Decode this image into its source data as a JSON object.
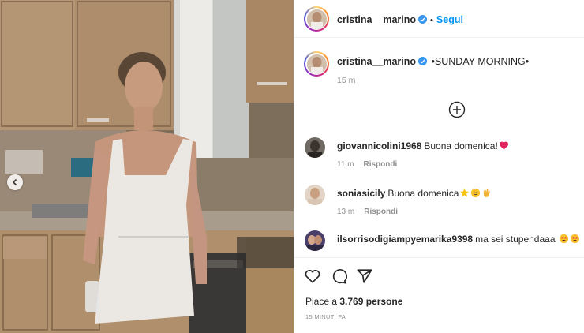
{
  "post": {
    "username": "cristina__marino",
    "follow_label": "Segui",
    "separator": "•",
    "caption": "•SUNDAY MORNING•",
    "caption_time": "15 m",
    "likes_prefix": "Piace a",
    "likes_count": "3.769",
    "likes_suffix": "persone",
    "posted_ago": "15 MINUTI FA"
  },
  "comments": [
    {
      "username": "giovannicolini1968",
      "text": "Buona domenica!",
      "emojis": [
        "red-heart"
      ],
      "time": "11 m",
      "reply_label": "Rispondi"
    },
    {
      "username": "soniasicily",
      "text": "Buona domenica",
      "emojis": [
        "star",
        "smiling-face",
        "waving-hand"
      ],
      "time": "13 m",
      "reply_label": "Rispondi"
    },
    {
      "username": "ilsorrisodigiampyemarika9398",
      "text": "ma sei stupendaaa",
      "emojis": [
        "star-struck",
        "star-struck"
      ],
      "time": "",
      "reply_label": ""
    }
  ],
  "icons": {
    "verified": "verified-badge-icon",
    "load_more": "plus-circle-icon",
    "like": "heart-icon",
    "comment": "comment-icon",
    "share": "paper-plane-icon",
    "carousel_prev": "chevron-left-icon"
  },
  "colors": {
    "accent": "#0095f6",
    "text": "#262626",
    "muted": "#8e8e8e",
    "border": "#efefef"
  }
}
